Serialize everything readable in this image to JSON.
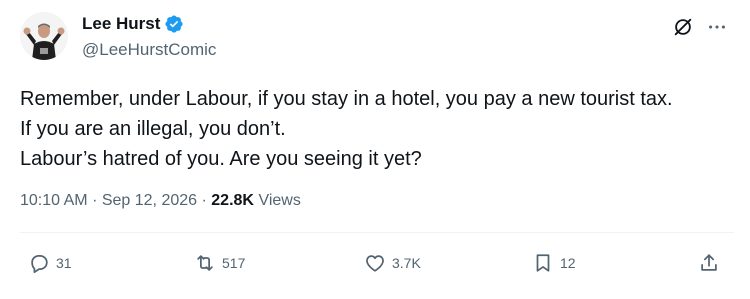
{
  "author": {
    "display_name": "Lee Hurst",
    "handle": "@LeeHurstComic",
    "verified": true
  },
  "tweet": {
    "lines": [
      "Remember, under Labour, if you stay in a hotel, you pay a new tourist tax.",
      "If you are an illegal, you don’t.",
      "Labour’s hatred of you. Are you seeing it yet?"
    ]
  },
  "meta": {
    "time": "10:10 AM",
    "separator": "·",
    "date": "Sep 12, 2026",
    "views_count": "22.8K",
    "views_label": "Views"
  },
  "actions": {
    "replies": "31",
    "reposts": "517",
    "likes": "3.7K",
    "bookmarks": "12"
  },
  "colors": {
    "verified": "#1d9bf0",
    "text_primary": "#0f1419",
    "text_secondary": "#536471",
    "divider": "#eff3f4"
  },
  "icons": [
    "verified-badge",
    "grok-icon",
    "more-icon",
    "reply-icon",
    "repost-icon",
    "like-icon",
    "bookmark-icon",
    "share-icon"
  ]
}
